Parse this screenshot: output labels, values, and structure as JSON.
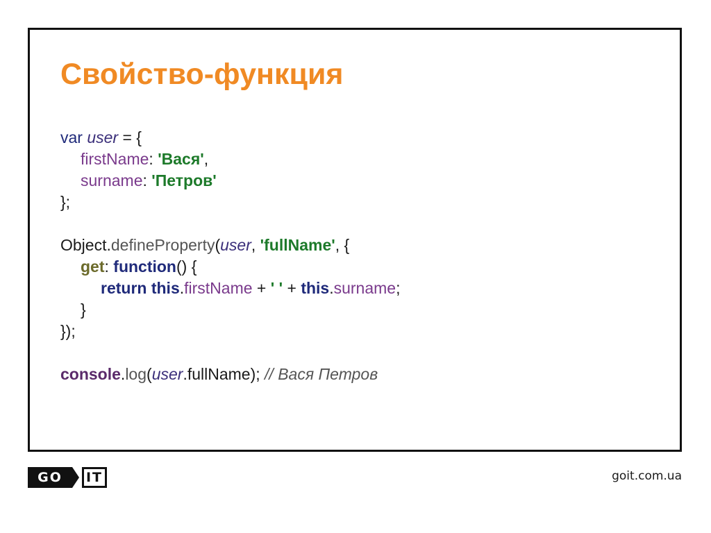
{
  "slide": {
    "title": "Свойство-функция"
  },
  "code": {
    "l1_var": "var",
    "l1_user": "user",
    "l1_eq": " = {",
    "l2_prop": "firstName",
    "l2_colon": ": ",
    "l2_str": "'Вася'",
    "l2_comma": ",",
    "l3_prop": "surname",
    "l3_colon": ": ",
    "l3_str": "'Петров'",
    "l4_close": "};",
    "l6_object": "Object.",
    "l6_method": "defineProperty",
    "l6_paren": "(",
    "l6_user": "user",
    "l6_comma": ", ",
    "l6_str": "'fullName'",
    "l6_rest": ", {",
    "l7_get": "get",
    "l7_colon": ": ",
    "l7_fn": "function",
    "l7_rest": "() {",
    "l8_return": "return",
    "l8_sp1": " ",
    "l8_this1": "this",
    "l8_dot1": ".",
    "l8_prop1": "firstName",
    "l8_plus1": " + ",
    "l8_space": "' '",
    "l8_plus2": " + ",
    "l8_this2": "this",
    "l8_dot2": ".",
    "l8_prop2": "surname",
    "l8_end": ";",
    "l9_close": "}",
    "l10_close": "});",
    "l12_console": "console",
    "l12_dot": ".",
    "l12_log": "log",
    "l12_paren": "(",
    "l12_user": "user",
    "l12_rest": ".fullName); ",
    "l12_comment": "// Вася Петров"
  },
  "footer": {
    "logo_go": "GO",
    "logo_it": "IT",
    "url": "goit.com.ua"
  },
  "colors": {
    "title": "#f08a24",
    "frame": "#111111",
    "string": "#1d7a2a",
    "keyword": "#1f2a7a",
    "property": "#7a3a8c"
  }
}
